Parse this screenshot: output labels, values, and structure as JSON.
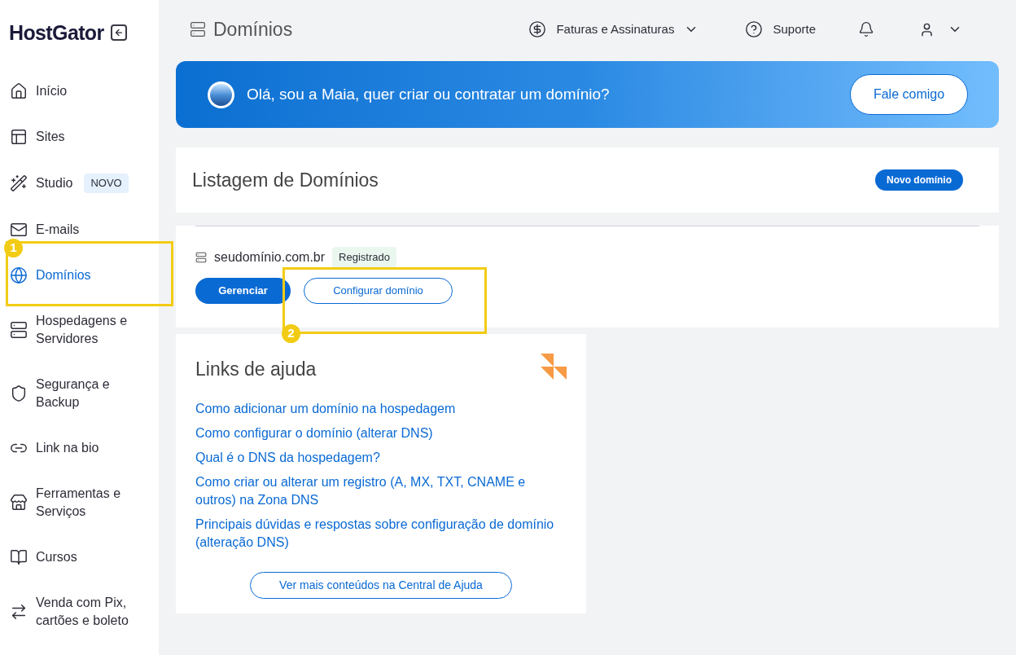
{
  "sidebar": {
    "logo": "HostGator",
    "items": [
      {
        "label": "Início",
        "selected": false
      },
      {
        "label": "Sites",
        "selected": false
      },
      {
        "label": "Studio",
        "badge": "NOVO",
        "selected": false
      },
      {
        "label": "E-mails",
        "selected": false
      },
      {
        "label": "Domínios",
        "selected": true
      },
      {
        "label": "Hospedagens e Servidores",
        "selected": false
      },
      {
        "label": "Segurança e Backup",
        "selected": false
      },
      {
        "label": "Link na bio",
        "selected": false
      },
      {
        "label": "Ferramentas e Serviços",
        "selected": false
      },
      {
        "label": "Cursos",
        "selected": false
      },
      {
        "label": "Venda com Pix, cartões e boleto",
        "selected": false
      }
    ]
  },
  "header": {
    "title": "Domínios",
    "billing": "Faturas e Assinaturas",
    "support": "Suporte"
  },
  "banner": {
    "text": "Olá, sou a Maia, quer criar ou contratar um domínio?",
    "button": "Fale comigo"
  },
  "listing": {
    "title": "Listagem de Domínios",
    "new_button": "Novo domínio"
  },
  "domain": {
    "name": "seudomínio.com.br",
    "status": "Registrado",
    "manage": "Gerenciar",
    "configure": "Configurar domínio"
  },
  "help": {
    "title": "Links de ajuda",
    "links": [
      "Como adicionar um domínio na hospedagem",
      "Como configurar o domínio (alterar DNS)",
      "Qual é o DNS da hospedagem?",
      "Como criar ou alterar um registro (A, MX, TXT, CNAME e outros) na Zona DNS",
      "Principais dúvidas e respostas sobre configuração de domínio (alteração DNS)"
    ],
    "more": "Ver mais conteúdos na Central de Ajuda"
  },
  "annotations": [
    {
      "number": "1"
    },
    {
      "number": "2"
    }
  ]
}
